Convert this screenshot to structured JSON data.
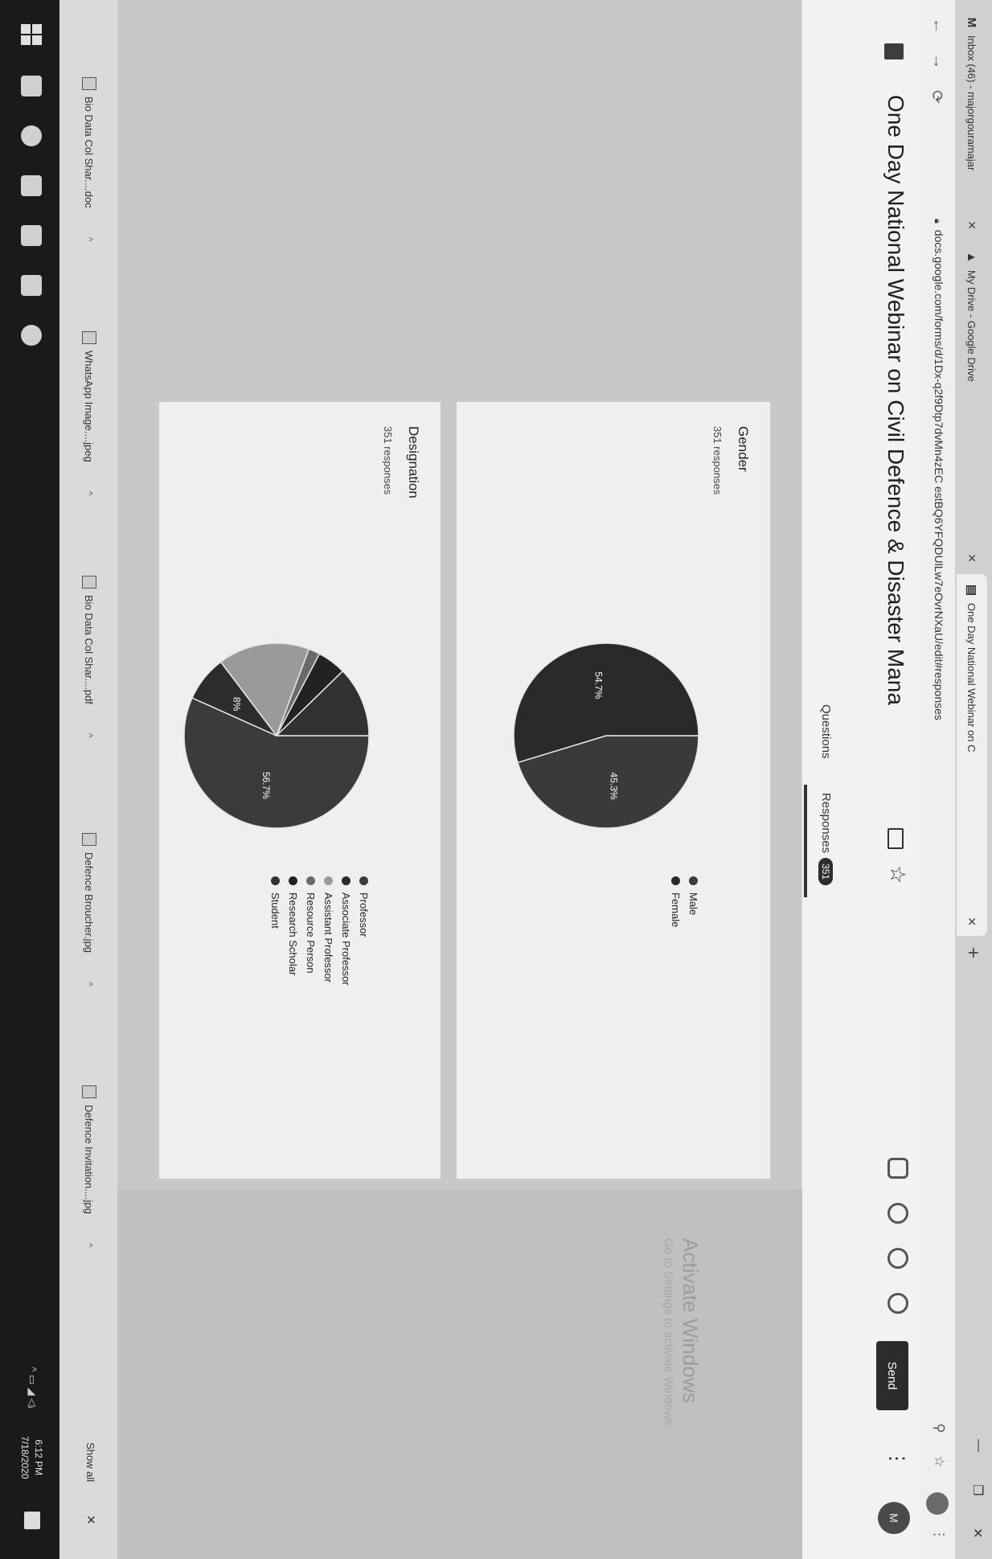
{
  "browser": {
    "tabs": [
      {
        "label": "Inbox (46) - majorgouramajar",
        "icon": "gmail-icon"
      },
      {
        "label": "My Drive - Google Drive",
        "icon": "drive-icon"
      },
      {
        "label": "One Day National Webinar on C",
        "icon": "forms-icon"
      }
    ],
    "url": "docs.google.com/forms/d/1Dx-q2f9Dtp7dvMn4zEC estBQ6YFQDUlLw7eOvrNXaU/edit#responses"
  },
  "form": {
    "title": "One Day National Webinar on Civil Defence & Disaster Mana",
    "send_label": "Send",
    "avatar_letter": "M",
    "tabs": {
      "questions": "Questions",
      "responses": "Responses",
      "responses_count": "351"
    }
  },
  "cards": [
    {
      "question": "Gender",
      "responses": "351 responses",
      "chart_data": {
        "type": "pie",
        "categories": [
          "Male",
          "Female"
        ],
        "values": [
          45.3,
          54.7
        ],
        "labels": [
          "45.3%",
          "54.7%"
        ],
        "colors": [
          "#3a3a3a",
          "#2a2a2a"
        ],
        "legend_position": "right"
      }
    },
    {
      "question": "Designation",
      "responses": "351 responses",
      "chart_data": {
        "type": "pie",
        "categories": [
          "Professor",
          "Associate Professor",
          "Assistant Professor",
          "Resource Person",
          "Research Scholar",
          "Student"
        ],
        "values": [
          56.7,
          8,
          16,
          2,
          5,
          12.3
        ],
        "labels": [
          "56.7%",
          "8%",
          "",
          "",
          "",
          ""
        ],
        "colors": [
          "#3b3b3b",
          "#2c2c2c",
          "#9a9a9a",
          "#6a6a6a",
          "#222222",
          "#313131"
        ],
        "legend_position": "right"
      }
    }
  ],
  "watermark": {
    "line1": "Activate Windows",
    "line2": "Go to Settings to activate Windows."
  },
  "downloads": [
    {
      "name": "Bio Data Col Shar....doc"
    },
    {
      "name": "WhatsApp Image....jpeg"
    },
    {
      "name": "Bio Data Col Shar....pdf"
    },
    {
      "name": "Defence Broucher.jpg"
    },
    {
      "name": "Defence Invitation....jpg"
    }
  ],
  "downloads_show_all": "Show all",
  "taskbar": {
    "time": "6:12 PM",
    "date": "7/18/2020"
  }
}
